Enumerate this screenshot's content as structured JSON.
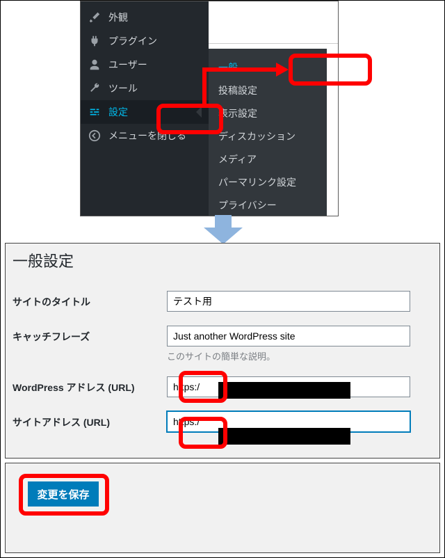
{
  "sidebar": {
    "items": [
      {
        "icon": "brush",
        "label": "外観"
      },
      {
        "icon": "plug",
        "label": "プラグイン"
      },
      {
        "icon": "user",
        "label": "ユーザー"
      },
      {
        "icon": "wrench",
        "label": "ツール"
      },
      {
        "icon": "sliders",
        "label": "設定"
      },
      {
        "icon": "collapse",
        "label": "メニューを閉じる"
      }
    ],
    "active_index": 4
  },
  "submenu": {
    "items": [
      "一般",
      "投稿設定",
      "表示設定",
      "ディスカッション",
      "メディア",
      "パーマリンク設定",
      "プライバシー"
    ],
    "current_index": 0
  },
  "settings": {
    "page_title": "一般設定",
    "rows": {
      "site_title": {
        "label": "サイトのタイトル",
        "value": "テスト用"
      },
      "tagline": {
        "label": "キャッチフレーズ",
        "value": "Just another WordPress site",
        "desc": "このサイトの簡単な説明。"
      },
      "wp_url": {
        "label": "WordPress アドレス (URL)",
        "value": "https:/"
      },
      "site_url": {
        "label": "サイトアドレス (URL)",
        "value": "https:/"
      }
    }
  },
  "save_button": {
    "label": "変更を保存"
  }
}
